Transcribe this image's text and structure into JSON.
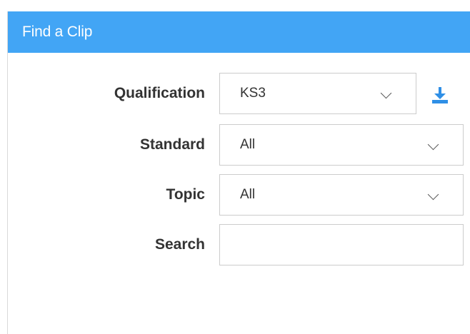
{
  "header": {
    "title": "Find a Clip"
  },
  "form": {
    "qualification": {
      "label": "Qualification",
      "value": "KS3"
    },
    "standard": {
      "label": "Standard",
      "value": "All"
    },
    "topic": {
      "label": "Topic",
      "value": "All"
    },
    "search": {
      "label": "Search",
      "value": "",
      "placeholder": ""
    }
  },
  "icons": {
    "download": "download-icon",
    "chevron": "chevron-down-icon"
  },
  "colors": {
    "header_bg": "#42a5f5",
    "accent": "#2f8fe6"
  }
}
